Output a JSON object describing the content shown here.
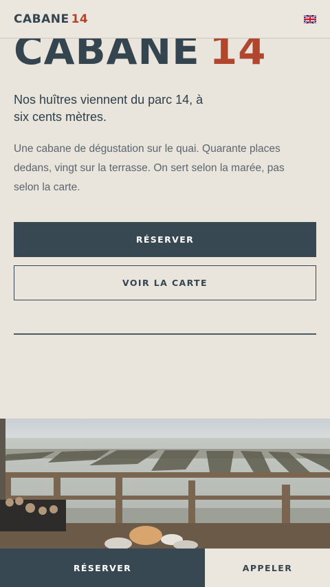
{
  "header": {
    "brand_name": "CABANE",
    "brand_number": "14",
    "language_icon": "uk-flag-icon"
  },
  "hero": {
    "title_name": "CABANE",
    "title_number": "14",
    "lead": "Nos huîtres viennent du parc 14, à six cents mètres.",
    "body": "Une cabane de dégustation sur le quai. Quarante places dedans, vingt sur la terrasse. On sert selon la marée, pas selon la carte."
  },
  "actions": {
    "reserve_label": "RÉSERVER",
    "menu_label": "VOIR LA CARTE"
  },
  "bottom_bar": {
    "reserve_label": "RÉSERVER",
    "call_label": "APPELER"
  },
  "colors": {
    "background": "#e9e4dc",
    "primary": "#384853",
    "accent": "#b0462e",
    "text": "#33444f"
  }
}
